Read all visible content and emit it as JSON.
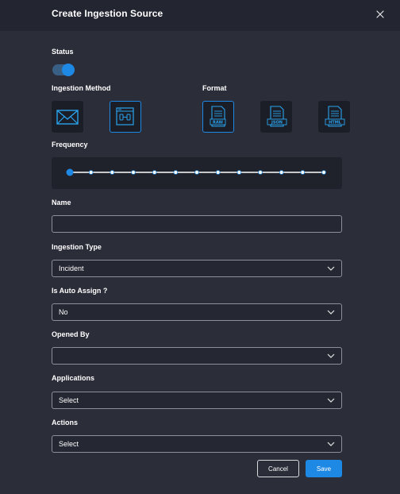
{
  "dialog": {
    "title": "Create Ingestion Source",
    "close_icon": "close-icon"
  },
  "status": {
    "label": "Status",
    "enabled": true
  },
  "ingestion_method": {
    "label": "Ingestion Method",
    "options": [
      {
        "icon": "email-envelope-icon",
        "selected": false
      },
      {
        "icon": "api-window-icon",
        "selected": true
      }
    ]
  },
  "format": {
    "label": "Format",
    "options": [
      {
        "badge": "RAW",
        "selected": true
      },
      {
        "badge": "JSON",
        "selected": false
      },
      {
        "badge": "HTML",
        "selected": false
      }
    ]
  },
  "frequency": {
    "label": "Frequency",
    "steps": 13,
    "selected_index": 0
  },
  "name": {
    "label": "Name",
    "value": ""
  },
  "ingestion_type": {
    "label": "Ingestion Type",
    "value": "Incident"
  },
  "auto_assign": {
    "label": "Is Auto Assign ?",
    "value": "No"
  },
  "opened_by": {
    "label": "Opened By",
    "value": ""
  },
  "applications": {
    "label": "Applications",
    "value": "Select"
  },
  "actions": {
    "label": "Actions",
    "value": "Select"
  },
  "buttons": {
    "cancel": "Cancel",
    "save": "Save"
  },
  "colors": {
    "accent": "#1e88e5",
    "background": "#2b2d39",
    "header": "#232531",
    "tile": "#1c1e27"
  }
}
